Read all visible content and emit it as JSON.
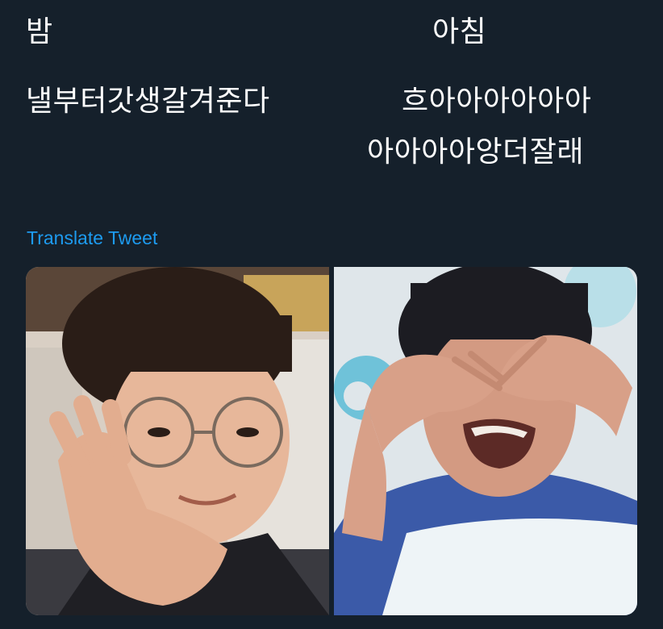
{
  "tweet": {
    "night_title": "밤",
    "morning_title": "아침",
    "night_text": "낼부터갓생갈겨준다",
    "morning_text_line1": "흐아아아아아아",
    "morning_text_line2": "아아아아앙더잘래",
    "translate_label": "Translate Tweet"
  },
  "colors": {
    "background": "#15202b",
    "text": "#ffffff",
    "link": "#1d9bf0"
  }
}
